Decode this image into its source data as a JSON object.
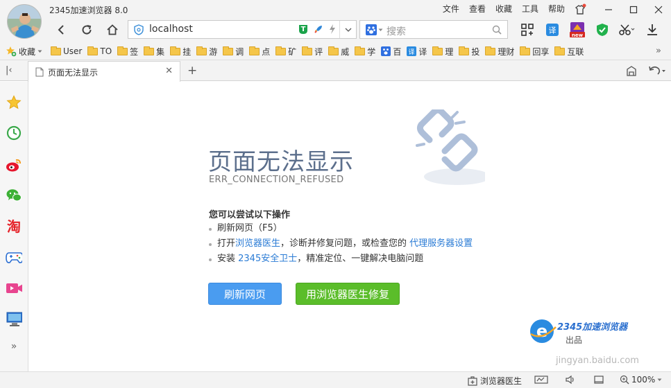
{
  "app": {
    "title": "2345加速浏览器 8.0"
  },
  "menu": {
    "items": [
      "文件",
      "查看",
      "收藏",
      "工具",
      "帮助"
    ]
  },
  "address": {
    "url": "localhost"
  },
  "search": {
    "placeholder": "搜索"
  },
  "bookmarks": {
    "favorites_label": "收藏",
    "items": [
      "User",
      "TO",
      "签",
      "集",
      "挂",
      "游",
      "调",
      "点",
      "矿",
      "评",
      "威",
      "学",
      "百",
      "译",
      "理",
      "投",
      "理财",
      "回享",
      "互联"
    ]
  },
  "tab": {
    "title": "页面无法显示"
  },
  "error": {
    "title": "页面无法显示",
    "code": "ERR_CONNECTION_REFUSED",
    "tips_heading": "您可以尝试以下操作",
    "tip1": "刷新网页（F5）",
    "tip2_prefix": "打开",
    "tip2_link1": "浏览器医生",
    "tip2_middle": "，诊断并修复问题，或检查您的 ",
    "tip2_link2": "代理服务器设置",
    "tip3_prefix": "安装 ",
    "tip3_link": "2345安全卫士",
    "tip3_suffix": "，精准定位、一键解决电脑问题",
    "refresh_button": "刷新网页",
    "doctor_button": "用浏览器医生修复"
  },
  "branding": {
    "name": "2345加速浏览器",
    "subtitle": "出品"
  },
  "watermark": "jingyan.baidu.com",
  "status": {
    "doctor_label": "浏览器医生",
    "zoom": "100%"
  },
  "colors": {
    "link": "#2a7bd5",
    "refresh_button": "#4a9cf0",
    "doctor_button": "#5bbd2a",
    "error_title": "#5c6f8c"
  }
}
